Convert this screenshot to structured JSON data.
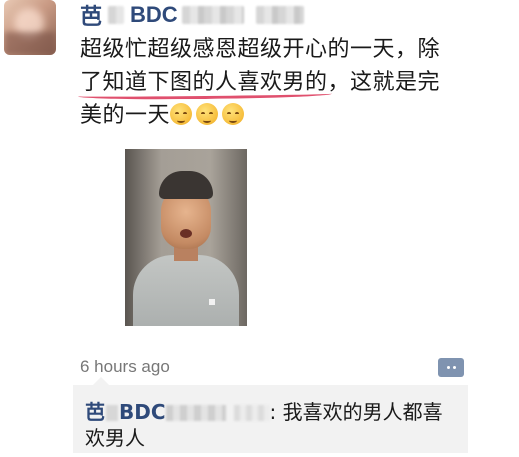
{
  "post": {
    "author_char": "芭",
    "author_suffix": "BDC",
    "text_line1": "超级忙超级感恩超级开心的一天，除",
    "text_line2_underlined": "了知道下图的人喜欢男的",
    "text_line2_rest": "，这就是完",
    "text_line3": "美的一天",
    "emojis": [
      "pensive-face",
      "pensive-face",
      "pensive-face"
    ],
    "timestamp": "6 hours ago"
  },
  "comment": {
    "author_char": "芭",
    "author_suffix": "BDC",
    "separator": ":",
    "text_line1": "我喜欢的男人都喜",
    "text_line2": "欢男人"
  },
  "colors": {
    "name": "#2f4a7a",
    "underline": "#e0506e",
    "comment_bg": "#f2f2f2",
    "comment_button": "#7f93b0",
    "timestamp": "#777777"
  }
}
